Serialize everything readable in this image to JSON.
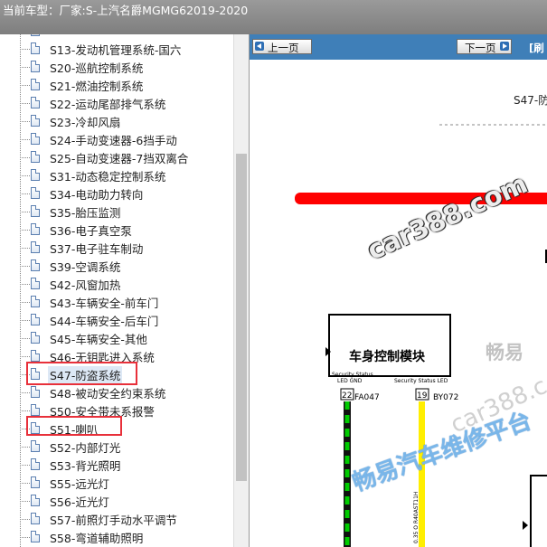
{
  "header": {
    "label": "当前车型：",
    "model": "厂家:S-上汽名爵MGMG62019-2020"
  },
  "tree": {
    "items": [
      {
        "label": "S13-发动机管理系统-国六"
      },
      {
        "label": "S20-巡航控制系统"
      },
      {
        "label": "S21-燃油控制系统"
      },
      {
        "label": "S22-运动尾部排气系统"
      },
      {
        "label": "S23-冷却风扇"
      },
      {
        "label": "S24-手动变速器-6挡手动"
      },
      {
        "label": "S25-自动变速器-7挡双离合"
      },
      {
        "label": "S31-动态稳定控制系统"
      },
      {
        "label": "S34-电动助力转向"
      },
      {
        "label": "S35-胎压监测"
      },
      {
        "label": "S36-电子真空泵"
      },
      {
        "label": "S37-电子驻车制动"
      },
      {
        "label": "S39-空调系统"
      },
      {
        "label": "S42-风窗加热"
      },
      {
        "label": "S43-车辆安全-前车门"
      },
      {
        "label": "S44-车辆安全-后车门"
      },
      {
        "label": "S45-车辆安全-其他"
      },
      {
        "label": "S46-无钥匙进入系统"
      },
      {
        "label": "S47-防盗系统",
        "selected": true,
        "highlight": true
      },
      {
        "label": "S48-被动安全约束系统"
      },
      {
        "label": "S50-安全带未系报警"
      },
      {
        "label": "S51-喇叭",
        "highlight": true
      },
      {
        "label": "S52-内部灯光"
      },
      {
        "label": "S53-背光照明"
      },
      {
        "label": "S55-远光灯"
      },
      {
        "label": "S56-近光灯"
      },
      {
        "label": "S57-前照灯手动水平调节"
      },
      {
        "label": "S58-弯道辅助照明"
      }
    ]
  },
  "viewer": {
    "prev_label": "上一页",
    "next_label": "下一页",
    "refresh_label": "[刷",
    "diagram": {
      "title": "S47-防",
      "module_name": "车身控制模块",
      "pin_left_label": "Security Status\nLED GND",
      "pin_right_label": "Security Status LED",
      "pin_left_number": "22",
      "pin_right_number": "19",
      "connector_left": "FA047",
      "connector_right": "BY072",
      "wire_label": "0.35  O  R40AST11H"
    },
    "watermarks": {
      "site": "car388.com",
      "brand_short": "畅易",
      "site_cut": "car388.c",
      "brand_full": "畅易汽车维修平台"
    }
  },
  "colors": {
    "nav_blue": "#3f7fb8",
    "wire_red": "#ff0000",
    "wire_yellow": "#ffee00",
    "wire_green": "#00a000",
    "highlight_box": "#e8303a"
  }
}
